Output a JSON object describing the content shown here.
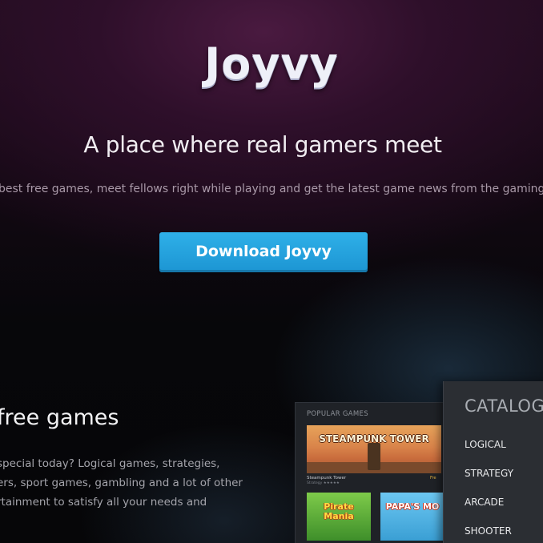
{
  "hero": {
    "logo_text": "Joyvy",
    "headline": "A place where real gamers meet",
    "subline": "best free games, meet fellows right while playing and get the latest game news from the gaming co",
    "download_label": "Download Joyvy"
  },
  "section": {
    "heading": "free games",
    "lines": [
      "special today? Logical games, strategies,",
      "ers, sport games, gambling and a lot of other",
      "rtainment to satisfy all your needs and"
    ]
  },
  "preview": {
    "title": "POPULAR GAMES",
    "featured": {
      "title": "STEAMPUNK TOWER",
      "caption": "Steampunk Tower",
      "sub": "Strategy ★★★★★",
      "price": "Fre"
    },
    "thumbs": [
      {
        "label": "Pirate\nMania"
      },
      {
        "label": "PAPA'S MO"
      }
    ]
  },
  "catalog": {
    "title": "CATALOG",
    "items": [
      "LOGICAL",
      "STRATEGY",
      "ARCADE",
      "SHOOTER"
    ]
  },
  "colors": {
    "accent": "#25a3dd",
    "background": "#060608",
    "hero_glow": "#4a1a40"
  }
}
